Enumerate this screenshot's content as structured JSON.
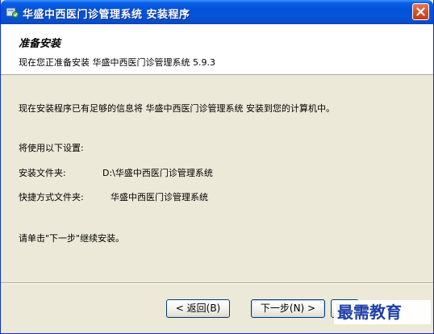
{
  "window": {
    "title": "华盛中西医门诊管理系统 安装程序",
    "close_icon": "close-icon",
    "app_icon": "installer-icon"
  },
  "header": {
    "title": "准备安装",
    "subtitle": "现在您正准备安装 华盛中西医门诊管理系统 5.9.3"
  },
  "body": {
    "intro": "现在安装程序已有足够的信息将 华盛中西医门诊管理系统 安装到您的计算机中。",
    "settings_heading": "将使用以下设置:",
    "install_folder_label": "安装文件夹:",
    "install_folder_value": "D:\\华盛中西医门诊管理系统",
    "shortcut_folder_label": "快捷方式文件夹:",
    "shortcut_folder_value": "华盛中西医门诊管理系统",
    "continue_text": "请单击\"下一步\"继续安装。"
  },
  "buttons": {
    "back": "< 返回(B)",
    "next": "下一步(N) >",
    "cancel": "取消"
  },
  "watermark": {
    "text": "最需教育"
  },
  "colors": {
    "titlebar": "#0454d8",
    "dialog_bg": "#ece9d8",
    "button_border": "#003c74",
    "watermark": "#1f3fa8"
  }
}
